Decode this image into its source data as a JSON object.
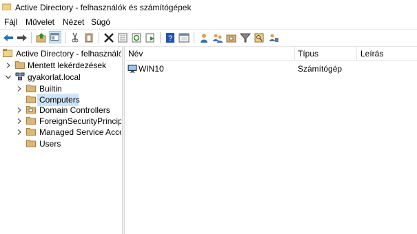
{
  "window": {
    "title": "Active Directory - felhasználók és számítógépek"
  },
  "menu": [
    "Fájl",
    "Művelet",
    "Nézet",
    "Súgó"
  ],
  "toolbar": {
    "icons": [
      "back-arrow-icon",
      "forward-arrow-icon",
      "up-folder-icon",
      "show-tree-icon",
      "cut-icon",
      "copy-icon",
      "delete-icon",
      "properties-icon",
      "refresh-icon",
      "export-icon",
      "help-icon",
      "console-tree-icon",
      "user-icon",
      "group-icon",
      "ou-icon",
      "filter-icon",
      "find-icon",
      "delegate-icon"
    ]
  },
  "tree": {
    "root": "Active Directory - felhasználók é",
    "saved_queries": "Mentett lekérdezések",
    "domain": "gyakorlat.local",
    "children": [
      "Builtin",
      "Computers",
      "Domain Controllers",
      "ForeignSecurityPrincipals",
      "Managed Service Accour",
      "Users"
    ],
    "selected": "Computers"
  },
  "list": {
    "columns": [
      "Név",
      "Típus",
      "Leírás"
    ],
    "rows": [
      {
        "name": "WIN10",
        "type": "Számítógép",
        "description": ""
      }
    ]
  },
  "colors": {
    "folder": "#dcb67a",
    "selection": "#cce4f7",
    "arrow_blue": "#1e73be"
  }
}
